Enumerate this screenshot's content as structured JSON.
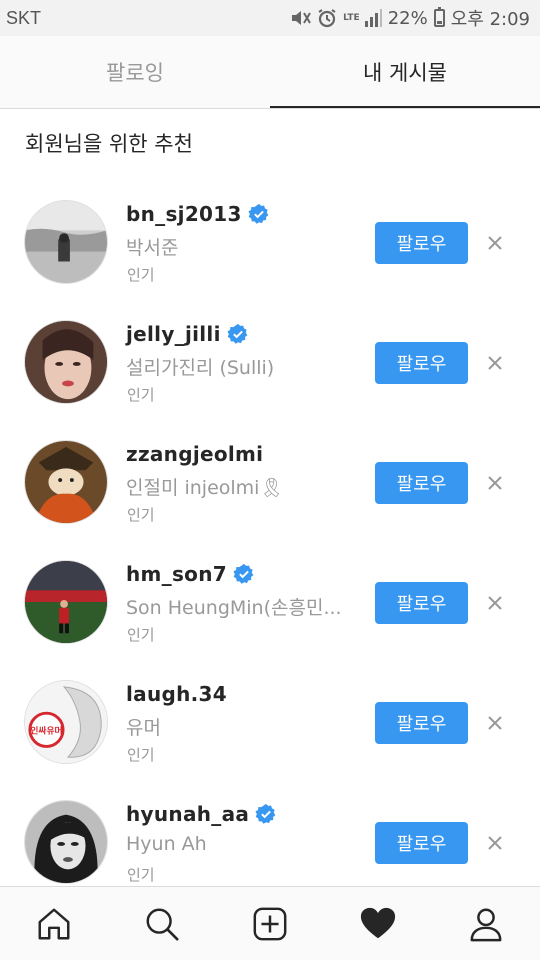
{
  "status_bar": {
    "carrier": "SKT",
    "network": "LTE",
    "battery": "22%",
    "battery_level": 0.22,
    "time": "오후 2:09"
  },
  "tabs": [
    {
      "label": "팔로잉",
      "active": false
    },
    {
      "label": "내 게시물",
      "active": true
    }
  ],
  "section_title": "회원님을 위한 추천",
  "suggestions": [
    {
      "username": "bn_sj2013",
      "verified": true,
      "full_name": "박서준",
      "reason": "인기",
      "follow_label": "팔로우"
    },
    {
      "username": "jelly_jilli",
      "verified": true,
      "full_name": "설리가진리 (Sulli)",
      "reason": "인기",
      "follow_label": "팔로우"
    },
    {
      "username": "zzangjeolmi",
      "verified": false,
      "full_name": "인절미 injeolmi🎗",
      "reason": "인기",
      "follow_label": "팔로우"
    },
    {
      "username": "hm_son7",
      "verified": true,
      "full_name": "Son HeungMin(손흥민...",
      "reason": "인기",
      "follow_label": "팔로우"
    },
    {
      "username": "laugh.34",
      "verified": false,
      "full_name": "유머",
      "reason": "인기",
      "follow_label": "팔로우",
      "avatar_text": "인싸유머"
    },
    {
      "username": "hyunah_aa",
      "verified": true,
      "full_name": "Hyun Ah",
      "reason": "인기",
      "follow_label": "팔로우"
    }
  ],
  "colors": {
    "accent": "#3897f0",
    "verified": "#3897f0",
    "secondary_text": "#999999"
  },
  "bottom_nav": [
    "home-icon",
    "search-icon",
    "new-post-icon",
    "activity-heart-icon",
    "profile-icon"
  ]
}
